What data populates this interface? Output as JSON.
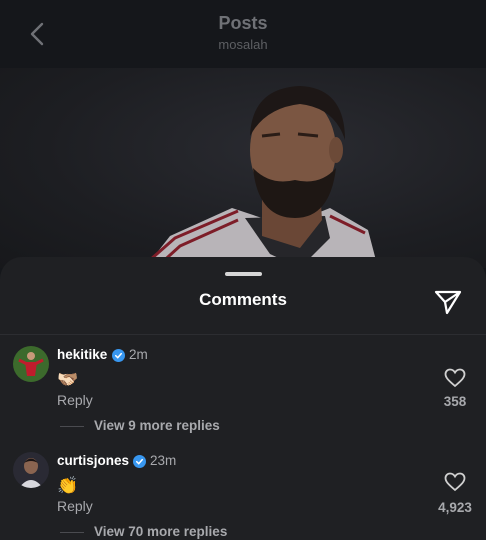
{
  "header": {
    "title": "Posts",
    "username": "mosalah"
  },
  "sheet": {
    "title": "Comments"
  },
  "comments": [
    {
      "username": "hekitike",
      "verified": true,
      "time": "2m",
      "emoji": "🫱🏻‍🫲🏽",
      "reply_label": "Reply",
      "view_replies": "View 9 more replies",
      "likes": "358"
    },
    {
      "username": "curtisjones",
      "verified": true,
      "time": "23m",
      "emoji": "👏",
      "reply_label": "Reply",
      "view_replies": "View 70 more replies",
      "likes": "4,923"
    }
  ],
  "colors": {
    "background": "#15171b",
    "sheet": "#1f2023",
    "verified_badge": "#3897f0",
    "secondary_text": "#a8a9ad"
  }
}
